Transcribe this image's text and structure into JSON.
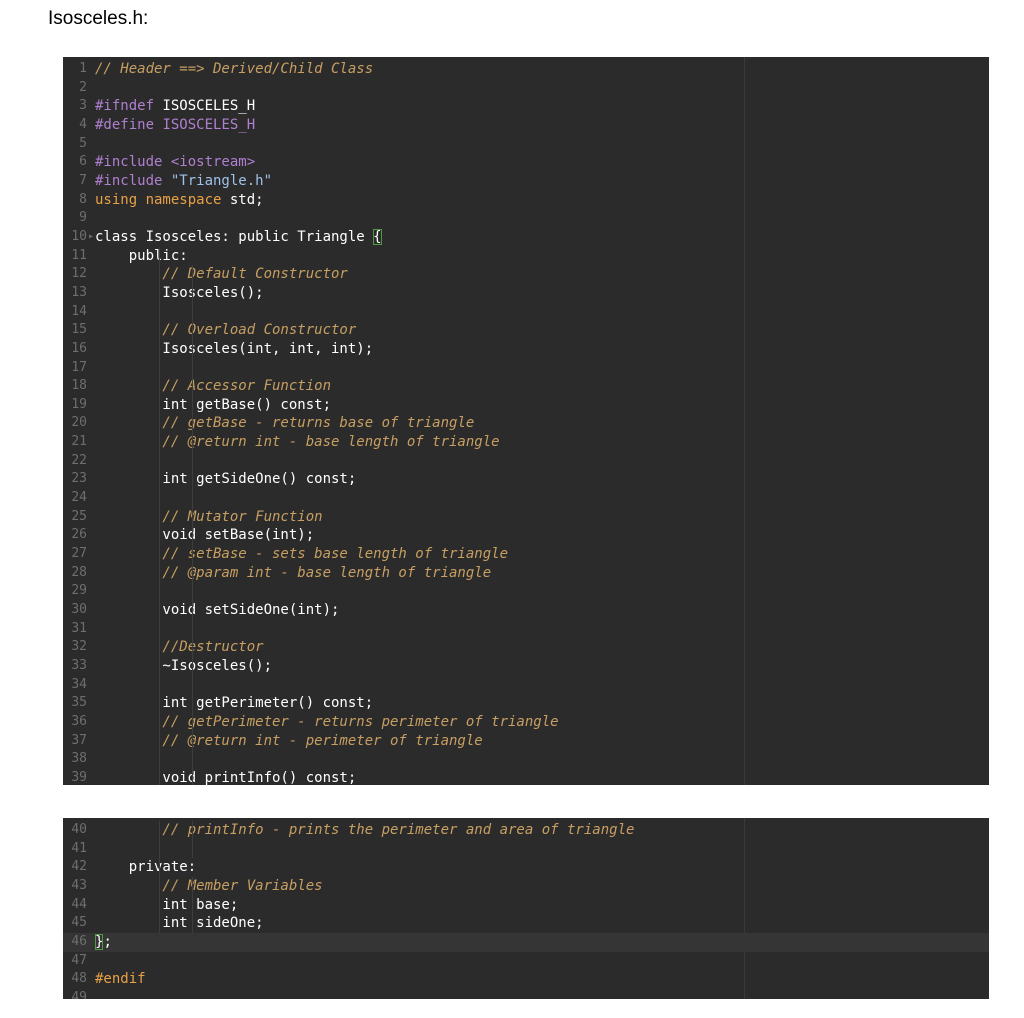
{
  "document": {
    "title": "Isosceles.h:"
  },
  "colors": {
    "background": "#2b2b2b",
    "default": "#ffffff",
    "comment": "#c79f62",
    "preprocessor": "#b07fd0",
    "keyword": "#e9a146",
    "string": "#9fc2e8",
    "line_number": "#6e6e6e",
    "bracket_highlight": "#4f9a45"
  },
  "panels": [
    {
      "id": "editor-panel-1",
      "lines": [
        {
          "n": "1",
          "tokens": [
            {
              "t": "// Header ==> Derived/Child Class",
              "c": "comment"
            }
          ]
        },
        {
          "n": "2",
          "tokens": []
        },
        {
          "n": "3",
          "tokens": [
            {
              "t": "#ifndef ",
              "c": "preprocessor"
            },
            {
              "t": "ISOSCELES_H",
              "c": "default"
            }
          ]
        },
        {
          "n": "4",
          "tokens": [
            {
              "t": "#define ",
              "c": "preprocessor"
            },
            {
              "t": "ISOSCELES_H",
              "c": "preprocessor"
            }
          ]
        },
        {
          "n": "5",
          "tokens": []
        },
        {
          "n": "6",
          "tokens": [
            {
              "t": "#include ",
              "c": "preprocessor"
            },
            {
              "t": "<iostream>",
              "c": "preprocessor"
            }
          ]
        },
        {
          "n": "7",
          "tokens": [
            {
              "t": "#include ",
              "c": "preprocessor"
            },
            {
              "t": "\"Triangle.h\"",
              "c": "string"
            }
          ]
        },
        {
          "n": "8",
          "tokens": [
            {
              "t": "using namespace ",
              "c": "keyword"
            },
            {
              "t": "std;",
              "c": "default"
            }
          ]
        },
        {
          "n": "9",
          "tokens": []
        },
        {
          "n": "10",
          "fold": true,
          "tokens": [
            {
              "t": "class Isosceles: public Triangle ",
              "c": "default"
            },
            {
              "t": "{",
              "c": "default",
              "hl": true
            }
          ]
        },
        {
          "n": "11",
          "tokens": [
            {
              "t": "    public:",
              "c": "default"
            }
          ]
        },
        {
          "n": "12",
          "tokens": [
            {
              "t": "        // Default Constructor",
              "c": "comment"
            }
          ]
        },
        {
          "n": "13",
          "tokens": [
            {
              "t": "        Isosceles();",
              "c": "default"
            }
          ]
        },
        {
          "n": "14",
          "tokens": []
        },
        {
          "n": "15",
          "tokens": [
            {
              "t": "        // Overload Constructor",
              "c": "comment"
            }
          ]
        },
        {
          "n": "16",
          "tokens": [
            {
              "t": "        Isosceles(int, int, int);",
              "c": "default"
            }
          ]
        },
        {
          "n": "17",
          "tokens": []
        },
        {
          "n": "18",
          "tokens": [
            {
              "t": "        // Accessor Function",
              "c": "comment"
            }
          ]
        },
        {
          "n": "19",
          "tokens": [
            {
              "t": "        int getBase() const;",
              "c": "default"
            }
          ]
        },
        {
          "n": "20",
          "tokens": [
            {
              "t": "        // getBase - returns base of triangle",
              "c": "comment"
            }
          ]
        },
        {
          "n": "21",
          "tokens": [
            {
              "t": "        // @return int - base length of triangle",
              "c": "comment"
            }
          ]
        },
        {
          "n": "22",
          "tokens": []
        },
        {
          "n": "23",
          "tokens": [
            {
              "t": "        int getSideOne() const;",
              "c": "default"
            }
          ]
        },
        {
          "n": "24",
          "tokens": []
        },
        {
          "n": "25",
          "tokens": [
            {
              "t": "        // Mutator Function",
              "c": "comment"
            }
          ]
        },
        {
          "n": "26",
          "tokens": [
            {
              "t": "        void setBase(int);",
              "c": "default"
            }
          ]
        },
        {
          "n": "27",
          "tokens": [
            {
              "t": "        // setBase - sets base length of triangle",
              "c": "comment"
            }
          ]
        },
        {
          "n": "28",
          "tokens": [
            {
              "t": "        // @param int - base length of triangle",
              "c": "comment"
            }
          ]
        },
        {
          "n": "29",
          "tokens": []
        },
        {
          "n": "30",
          "tokens": [
            {
              "t": "        void setSideOne(int);",
              "c": "default"
            }
          ]
        },
        {
          "n": "31",
          "tokens": []
        },
        {
          "n": "32",
          "tokens": [
            {
              "t": "        //Destructor",
              "c": "comment"
            }
          ]
        },
        {
          "n": "33",
          "tokens": [
            {
              "t": "        ~Isosceles();",
              "c": "default"
            }
          ]
        },
        {
          "n": "34",
          "tokens": []
        },
        {
          "n": "35",
          "tokens": [
            {
              "t": "        int getPerimeter() const;",
              "c": "default"
            }
          ]
        },
        {
          "n": "36",
          "tokens": [
            {
              "t": "        // getPerimeter - returns perimeter of triangle",
              "c": "comment"
            }
          ]
        },
        {
          "n": "37",
          "tokens": [
            {
              "t": "        // @return int - perimeter of triangle",
              "c": "comment"
            }
          ]
        },
        {
          "n": "38",
          "tokens": []
        },
        {
          "n": "39",
          "tokens": [
            {
              "t": "        void printInfo() const;",
              "c": "default"
            }
          ]
        }
      ]
    },
    {
      "id": "editor-panel-2",
      "lines": [
        {
          "n": "40",
          "tokens": [
            {
              "t": "        // printInfo - prints the perimeter and area of triangle",
              "c": "comment"
            }
          ]
        },
        {
          "n": "41",
          "tokens": []
        },
        {
          "n": "42",
          "tokens": [
            {
              "t": "    private:",
              "c": "default"
            }
          ]
        },
        {
          "n": "43",
          "tokens": [
            {
              "t": "        // Member Variables",
              "c": "comment"
            }
          ]
        },
        {
          "n": "44",
          "tokens": [
            {
              "t": "        int base;",
              "c": "default"
            }
          ]
        },
        {
          "n": "45",
          "tokens": [
            {
              "t": "        int sideOne;",
              "c": "default"
            }
          ]
        },
        {
          "n": "46",
          "current": true,
          "tokens": [
            {
              "t": "}",
              "c": "default",
              "hl": true
            },
            {
              "t": ";",
              "c": "default"
            }
          ]
        },
        {
          "n": "47",
          "tokens": []
        },
        {
          "n": "48",
          "tokens": [
            {
              "t": "#endif",
              "c": "keyword"
            }
          ]
        },
        {
          "n": "49",
          "tokens": []
        }
      ]
    }
  ]
}
